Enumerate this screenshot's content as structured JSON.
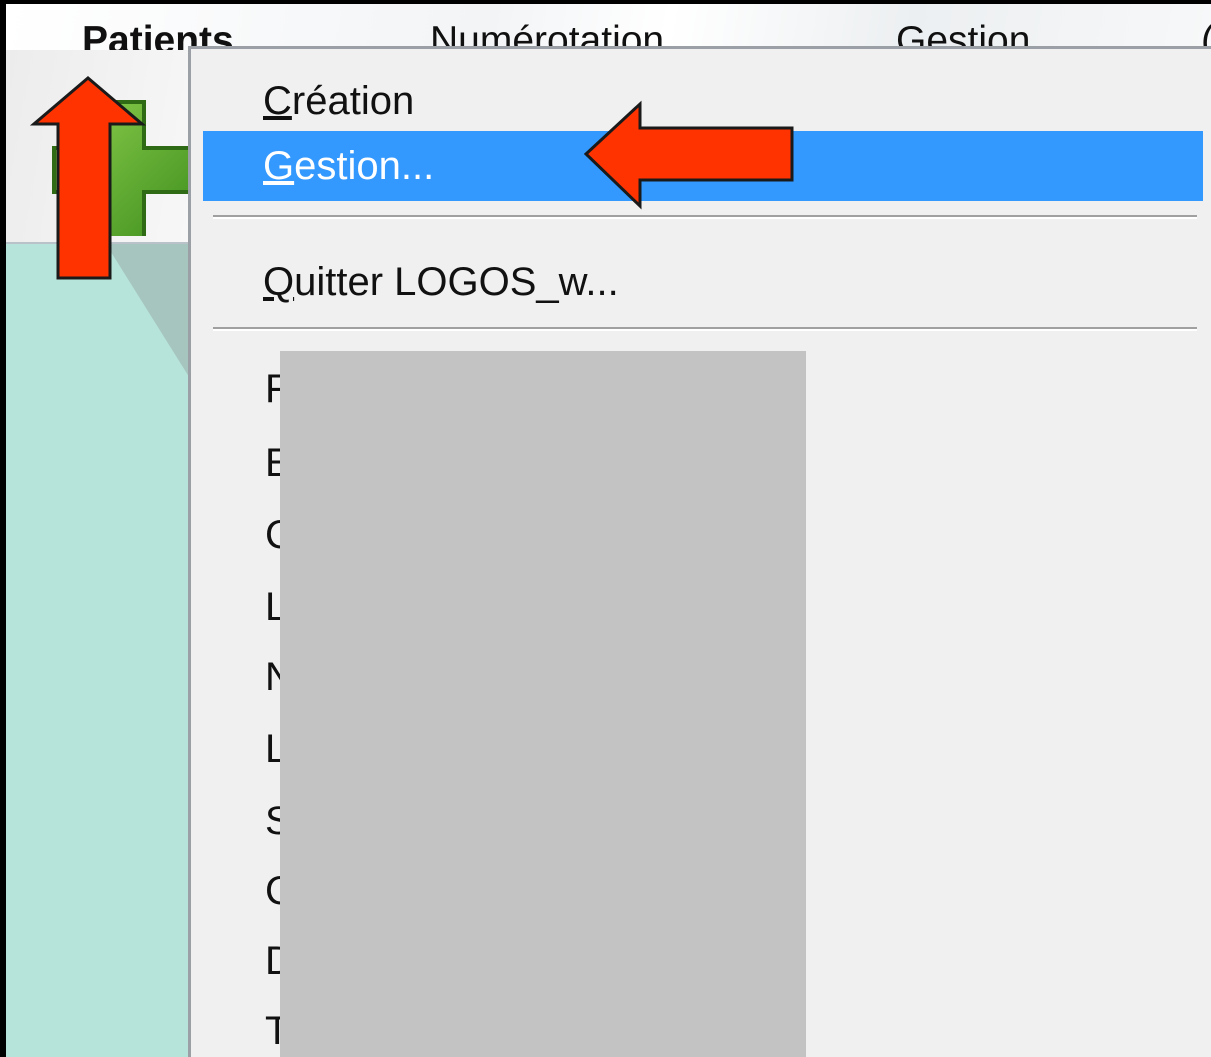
{
  "menubar": {
    "items": [
      {
        "label": "Patients"
      },
      {
        "label": "Numérotation"
      },
      {
        "label": "Gestion"
      },
      {
        "label": "("
      }
    ]
  },
  "toolbar": {
    "add_icon": "green-plus-icon"
  },
  "dropdown": {
    "creation": {
      "first": "C",
      "rest": "réation"
    },
    "gestion": {
      "first": "G",
      "rest": "estion..."
    },
    "quitter": {
      "first": "Q",
      "rest": "uitter LOGOS_w..."
    },
    "truncated_items": [
      "F",
      "E",
      "C",
      "L",
      "N",
      "L",
      "S",
      "C",
      "D",
      "T"
    ],
    "redacted": true
  },
  "annotations": {
    "arrow_color": "#ff3300",
    "arrows": [
      "arrow-up-icon",
      "arrow-left-icon"
    ]
  },
  "colors": {
    "highlight": "#3399ff",
    "workspace": "#b6e4da"
  }
}
